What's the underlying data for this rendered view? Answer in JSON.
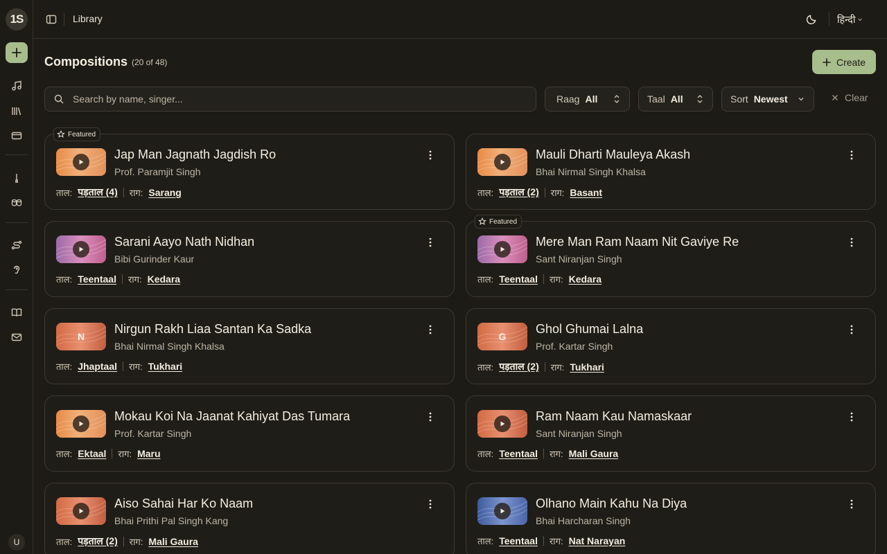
{
  "app": {
    "logo_text": "1S",
    "user_initial": "U"
  },
  "sidebar": {
    "items": [
      {
        "icon": "music-note-icon"
      },
      {
        "icon": "library-icon"
      },
      {
        "icon": "card-icon"
      },
      {
        "icon": "metronome-icon"
      },
      {
        "icon": "drums-icon"
      },
      {
        "icon": "route-icon"
      },
      {
        "icon": "ear-icon"
      },
      {
        "icon": "book-icon"
      },
      {
        "icon": "mail-icon"
      }
    ]
  },
  "topbar": {
    "breadcrumb": "Library",
    "language": "हिन्दी"
  },
  "header": {
    "title": "Compositions",
    "count": "(20 of 48)",
    "create_label": "Create"
  },
  "filters": {
    "search_placeholder": "Search by name, singer...",
    "raag_label": "Raag",
    "raag_value": "All",
    "taal_label": "Taal",
    "taal_value": "All",
    "sort_label": "Sort",
    "sort_value": "Newest",
    "clear_label": "Clear"
  },
  "labels": {
    "featured": "Featured",
    "taal": "ताल:",
    "raag": "राग:"
  },
  "colors": {
    "accent": "#a8bd8c",
    "background": "#1d1b16"
  },
  "compositions": [
    {
      "title": "Jap Man Jagnath Jagdish Ro",
      "singer": "Prof. Paramjit Singh",
      "taal": "पड़ताल (4)",
      "raag": "Sarang",
      "featured": true,
      "thumb": "play"
    },
    {
      "title": "Mauli Dharti Mauleya Akash",
      "singer": "Bhai Nirmal Singh Khalsa",
      "taal": "पड़ताल (2)",
      "raag": "Basant",
      "featured": false,
      "thumb": "play"
    },
    {
      "title": "Sarani Aayo Nath Nidhan",
      "singer": "Bibi Gurinder Kaur",
      "taal": "Teentaal",
      "raag": "Kedara",
      "featured": false,
      "thumb": "play"
    },
    {
      "title": "Mere Man Ram Naam Nit Gaviye Re",
      "singer": "Sant Niranjan Singh",
      "taal": "Teentaal",
      "raag": "Kedara",
      "featured": true,
      "thumb": "play"
    },
    {
      "title": "Nirgun Rakh Liaa Santan Ka Sadka",
      "singer": "Bhai Nirmal Singh Khalsa",
      "taal": "Jhaptaal",
      "raag": "Tukhari",
      "featured": false,
      "thumb": "N"
    },
    {
      "title": "Ghol Ghumai Lalna",
      "singer": "Prof. Kartar Singh",
      "taal": "पड़ताल (2)",
      "raag": "Tukhari",
      "featured": false,
      "thumb": "G"
    },
    {
      "title": "Mokau Koi Na Jaanat Kahiyat Das Tumara",
      "singer": "Prof. Kartar Singh",
      "taal": "Ektaal",
      "raag": "Maru",
      "featured": false,
      "thumb": "play"
    },
    {
      "title": "Ram Naam Kau Namaskaar",
      "singer": "Sant Niranjan Singh",
      "taal": "Teentaal",
      "raag": "Mali Gaura",
      "featured": false,
      "thumb": "play"
    },
    {
      "title": "Aiso Sahai Har Ko Naam",
      "singer": "Bhai Prithi Pal Singh Kang",
      "taal": "पड़ताल (2)",
      "raag": "Mali Gaura",
      "featured": false,
      "thumb": "play"
    },
    {
      "title": "Olhano Main Kahu Na Diya",
      "singer": "Bhai Harcharan Singh",
      "taal": "Teentaal",
      "raag": "Nat Narayan",
      "featured": false,
      "thumb": "play"
    }
  ]
}
